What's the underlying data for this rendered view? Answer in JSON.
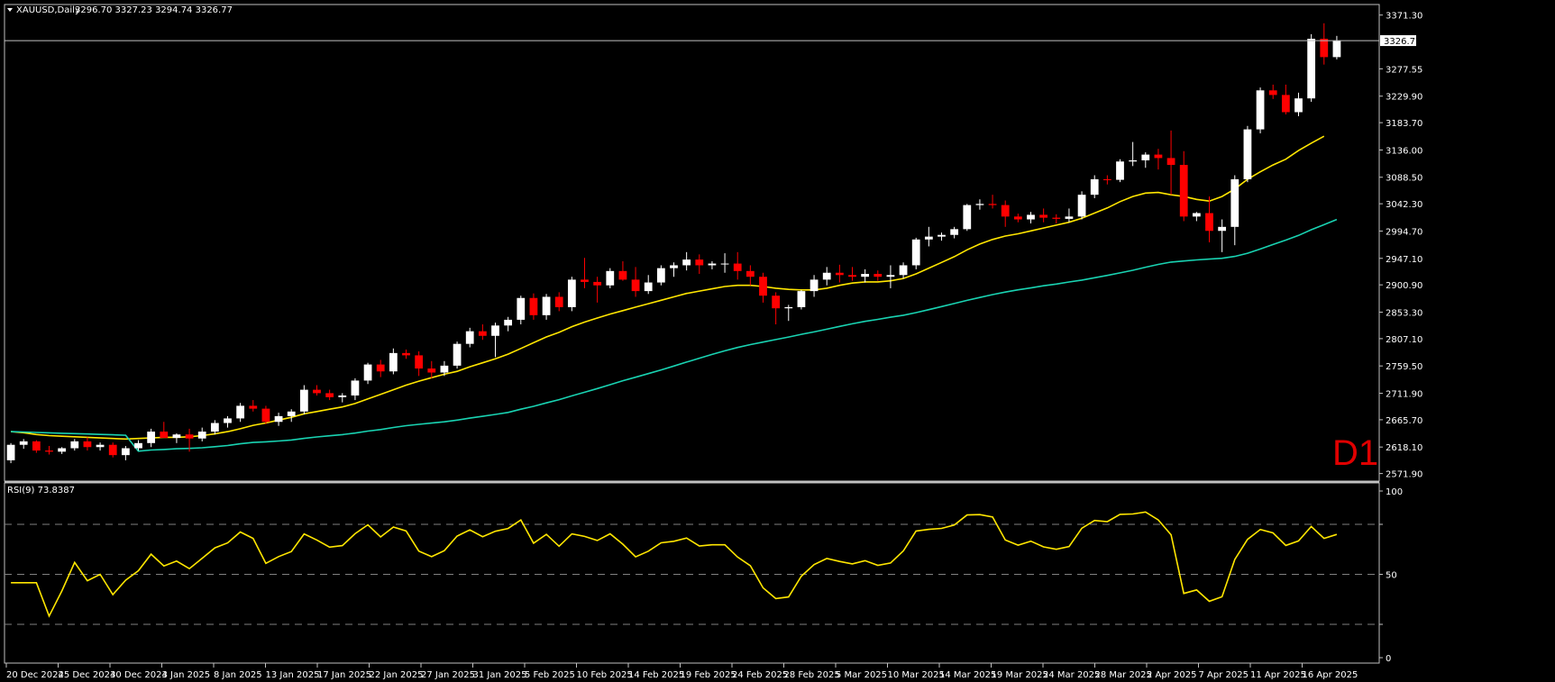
{
  "header": {
    "menu_arrow": "triangle-down-icon",
    "symbol": "XAUUSD,Daily",
    "ohlc": "3296.70 3327.23 3294.74 3326.77"
  },
  "timeframe_badge": "D1",
  "current_price_label": "3326.77",
  "rsi": {
    "label": "RSI(9) 73.8387",
    "levels": [
      20,
      50,
      80
    ],
    "ticks": [
      "100",
      "50",
      "0"
    ],
    "range": [
      0,
      100
    ]
  },
  "colors": {
    "bull": "#ffffff",
    "bear": "#ff0000",
    "ma_fast": "#ffe600",
    "ma_slow": "#19d3b2",
    "rsi_line": "#ffe600",
    "grid": "#808080"
  },
  "chart_data": {
    "type": "candlestick",
    "title": "XAUUSD,Daily",
    "y_ticks": [
      "3371.30",
      "3277.55",
      "3229.90",
      "3183.70",
      "3136.00",
      "3088.50",
      "3042.30",
      "2994.70",
      "2947.10",
      "2900.90",
      "2853.30",
      "2807.10",
      "2759.50",
      "2711.90",
      "2665.70",
      "2618.10",
      "2571.90"
    ],
    "ylim": [
      2565,
      3385
    ],
    "x_labels": [
      "20 Dec 2024",
      "25 Dec 2024",
      "30 Dec 2024",
      "3 Jan 2025",
      "8 Jan 2025",
      "13 Jan 2025",
      "17 Jan 2025",
      "22 Jan 2025",
      "27 Jan 2025",
      "31 Jan 2025",
      "5 Feb 2025",
      "10 Feb 2025",
      "14 Feb 2025",
      "19 Feb 2025",
      "24 Feb 2025",
      "28 Feb 2025",
      "5 Mar 2025",
      "10 Mar 2025",
      "14 Mar 2025",
      "19 Mar 2025",
      "24 Mar 2025",
      "28 Mar 2025",
      "2 Apr 2025",
      "7 Apr 2025",
      "11 Apr 2025",
      "16 Apr 2025"
    ],
    "candles": [
      [
        2595,
        2625,
        2590,
        2622
      ],
      [
        2622,
        2632,
        2615,
        2628
      ],
      [
        2628,
        2630,
        2608,
        2612
      ],
      [
        2612,
        2620,
        2605,
        2610
      ],
      [
        2610,
        2618,
        2606,
        2616
      ],
      [
        2616,
        2632,
        2612,
        2628
      ],
      [
        2628,
        2635,
        2612,
        2618
      ],
      [
        2618,
        2626,
        2612,
        2622
      ],
      [
        2622,
        2626,
        2600,
        2604
      ],
      [
        2604,
        2620,
        2595,
        2616
      ],
      [
        2616,
        2630,
        2612,
        2625
      ],
      [
        2625,
        2650,
        2618,
        2645
      ],
      [
        2645,
        2662,
        2638,
        2634
      ],
      [
        2634,
        2642,
        2625,
        2640
      ],
      [
        2640,
        2650,
        2610,
        2633
      ],
      [
        2633,
        2652,
        2628,
        2645
      ],
      [
        2645,
        2665,
        2640,
        2660
      ],
      [
        2660,
        2672,
        2652,
        2668
      ],
      [
        2668,
        2695,
        2662,
        2690
      ],
      [
        2690,
        2700,
        2680,
        2685
      ],
      [
        2685,
        2690,
        2658,
        2662
      ],
      [
        2662,
        2678,
        2655,
        2672
      ],
      [
        2672,
        2684,
        2662,
        2680
      ],
      [
        2680,
        2726,
        2675,
        2718
      ],
      [
        2718,
        2726,
        2708,
        2712
      ],
      [
        2712,
        2718,
        2700,
        2705
      ],
      [
        2705,
        2712,
        2696,
        2708
      ],
      [
        2708,
        2738,
        2700,
        2734
      ],
      [
        2734,
        2765,
        2728,
        2762
      ],
      [
        2762,
        2770,
        2740,
        2750
      ],
      [
        2750,
        2790,
        2745,
        2782
      ],
      [
        2782,
        2788,
        2772,
        2778
      ],
      [
        2778,
        2785,
        2742,
        2755
      ],
      [
        2755,
        2768,
        2738,
        2748
      ],
      [
        2748,
        2768,
        2742,
        2760
      ],
      [
        2760,
        2802,
        2755,
        2798
      ],
      [
        2798,
        2826,
        2792,
        2820
      ],
      [
        2820,
        2832,
        2805,
        2812
      ],
      [
        2812,
        2835,
        2775,
        2830
      ],
      [
        2830,
        2845,
        2820,
        2840
      ],
      [
        2840,
        2882,
        2832,
        2878
      ],
      [
        2878,
        2886,
        2840,
        2848
      ],
      [
        2848,
        2885,
        2840,
        2880
      ],
      [
        2880,
        2888,
        2855,
        2862
      ],
      [
        2862,
        2915,
        2855,
        2910
      ],
      [
        2910,
        2948,
        2895,
        2906
      ],
      [
        2906,
        2915,
        2870,
        2900
      ],
      [
        2900,
        2930,
        2895,
        2925
      ],
      [
        2925,
        2942,
        2908,
        2910
      ],
      [
        2910,
        2932,
        2880,
        2890
      ],
      [
        2890,
        2918,
        2885,
        2905
      ],
      [
        2905,
        2935,
        2900,
        2930
      ],
      [
        2930,
        2940,
        2915,
        2935
      ],
      [
        2935,
        2958,
        2926,
        2945
      ],
      [
        2945,
        2954,
        2920,
        2935
      ],
      [
        2935,
        2942,
        2928,
        2938
      ],
      [
        2938,
        2956,
        2922,
        2938
      ],
      [
        2938,
        2958,
        2910,
        2925
      ],
      [
        2925,
        2935,
        2900,
        2915
      ],
      [
        2915,
        2922,
        2870,
        2882
      ],
      [
        2882,
        2888,
        2832,
        2860
      ],
      [
        2860,
        2866,
        2838,
        2862
      ],
      [
        2862,
        2892,
        2858,
        2890
      ],
      [
        2890,
        2918,
        2880,
        2910
      ],
      [
        2910,
        2932,
        2900,
        2922
      ],
      [
        2922,
        2936,
        2905,
        2918
      ],
      [
        2918,
        2932,
        2908,
        2915
      ],
      [
        2915,
        2928,
        2905,
        2920
      ],
      [
        2920,
        2926,
        2908,
        2915
      ],
      [
        2915,
        2935,
        2895,
        2918
      ],
      [
        2918,
        2940,
        2912,
        2935
      ],
      [
        2935,
        2983,
        2928,
        2980
      ],
      [
        2980,
        3002,
        2968,
        2985
      ],
      [
        2985,
        2992,
        2978,
        2988
      ],
      [
        2988,
        3002,
        2982,
        2998
      ],
      [
        2998,
        3042,
        2995,
        3040
      ],
      [
        3040,
        3050,
        3032,
        3042
      ],
      [
        3042,
        3058,
        3034,
        3040
      ],
      [
        3040,
        3048,
        3002,
        3020
      ],
      [
        3020,
        3025,
        3010,
        3015
      ],
      [
        3015,
        3028,
        3008,
        3023
      ],
      [
        3023,
        3034,
        3010,
        3018
      ],
      [
        3018,
        3024,
        3008,
        3016
      ],
      [
        3016,
        3034,
        3010,
        3020
      ],
      [
        3020,
        3064,
        3015,
        3058
      ],
      [
        3058,
        3092,
        3052,
        3085
      ],
      [
        3085,
        3092,
        3076,
        3084
      ],
      [
        3084,
        3120,
        3080,
        3116
      ],
      [
        3116,
        3150,
        3108,
        3118
      ],
      [
        3118,
        3132,
        3105,
        3128
      ],
      [
        3128,
        3138,
        3102,
        3122
      ],
      [
        3122,
        3170,
        3058,
        3110
      ],
      [
        3110,
        3134,
        3012,
        3020
      ],
      [
        3020,
        3028,
        3012,
        3026
      ],
      [
        3026,
        3055,
        2975,
        2995
      ],
      [
        2995,
        3015,
        2958,
        3002
      ],
      [
        3002,
        3092,
        2970,
        3085
      ],
      [
        3085,
        3178,
        3080,
        3172
      ],
      [
        3172,
        3245,
        3165,
        3240
      ],
      [
        3240,
        3250,
        3225,
        3232
      ],
      [
        3232,
        3250,
        3198,
        3202
      ],
      [
        3202,
        3236,
        3195,
        3226
      ],
      [
        3226,
        3338,
        3220,
        3330
      ],
      [
        3330,
        3357,
        3285,
        3298
      ],
      [
        3298,
        3335,
        3294,
        3327
      ]
    ],
    "ma_fast": [
      2645,
      2643,
      2640,
      2638,
      2637,
      2636,
      2635,
      2634,
      2633,
      2632,
      2633,
      2634,
      2635,
      2635,
      2636,
      2638,
      2641,
      2645,
      2650,
      2656,
      2660,
      2665,
      2670,
      2676,
      2680,
      2684,
      2688,
      2694,
      2702,
      2710,
      2718,
      2726,
      2733,
      2739,
      2745,
      2750,
      2758,
      2765,
      2772,
      2780,
      2790,
      2800,
      2810,
      2818,
      2828,
      2836,
      2843,
      2850,
      2856,
      2862,
      2868,
      2874,
      2880,
      2886,
      2890,
      2894,
      2898,
      2900,
      2900,
      2898,
      2895,
      2893,
      2892,
      2892,
      2895,
      2900,
      2904,
      2906,
      2906,
      2908,
      2912,
      2920,
      2930,
      2940,
      2950,
      2962,
      2972,
      2980,
      2986,
      2990,
      2995,
      3000,
      3005,
      3010,
      3017,
      3026,
      3035,
      3046,
      3055,
      3061,
      3062,
      3058,
      3055,
      3050,
      3047,
      3055,
      3068,
      3085,
      3098,
      3110,
      3120,
      3135,
      3148,
      3160
    ]
  }
}
